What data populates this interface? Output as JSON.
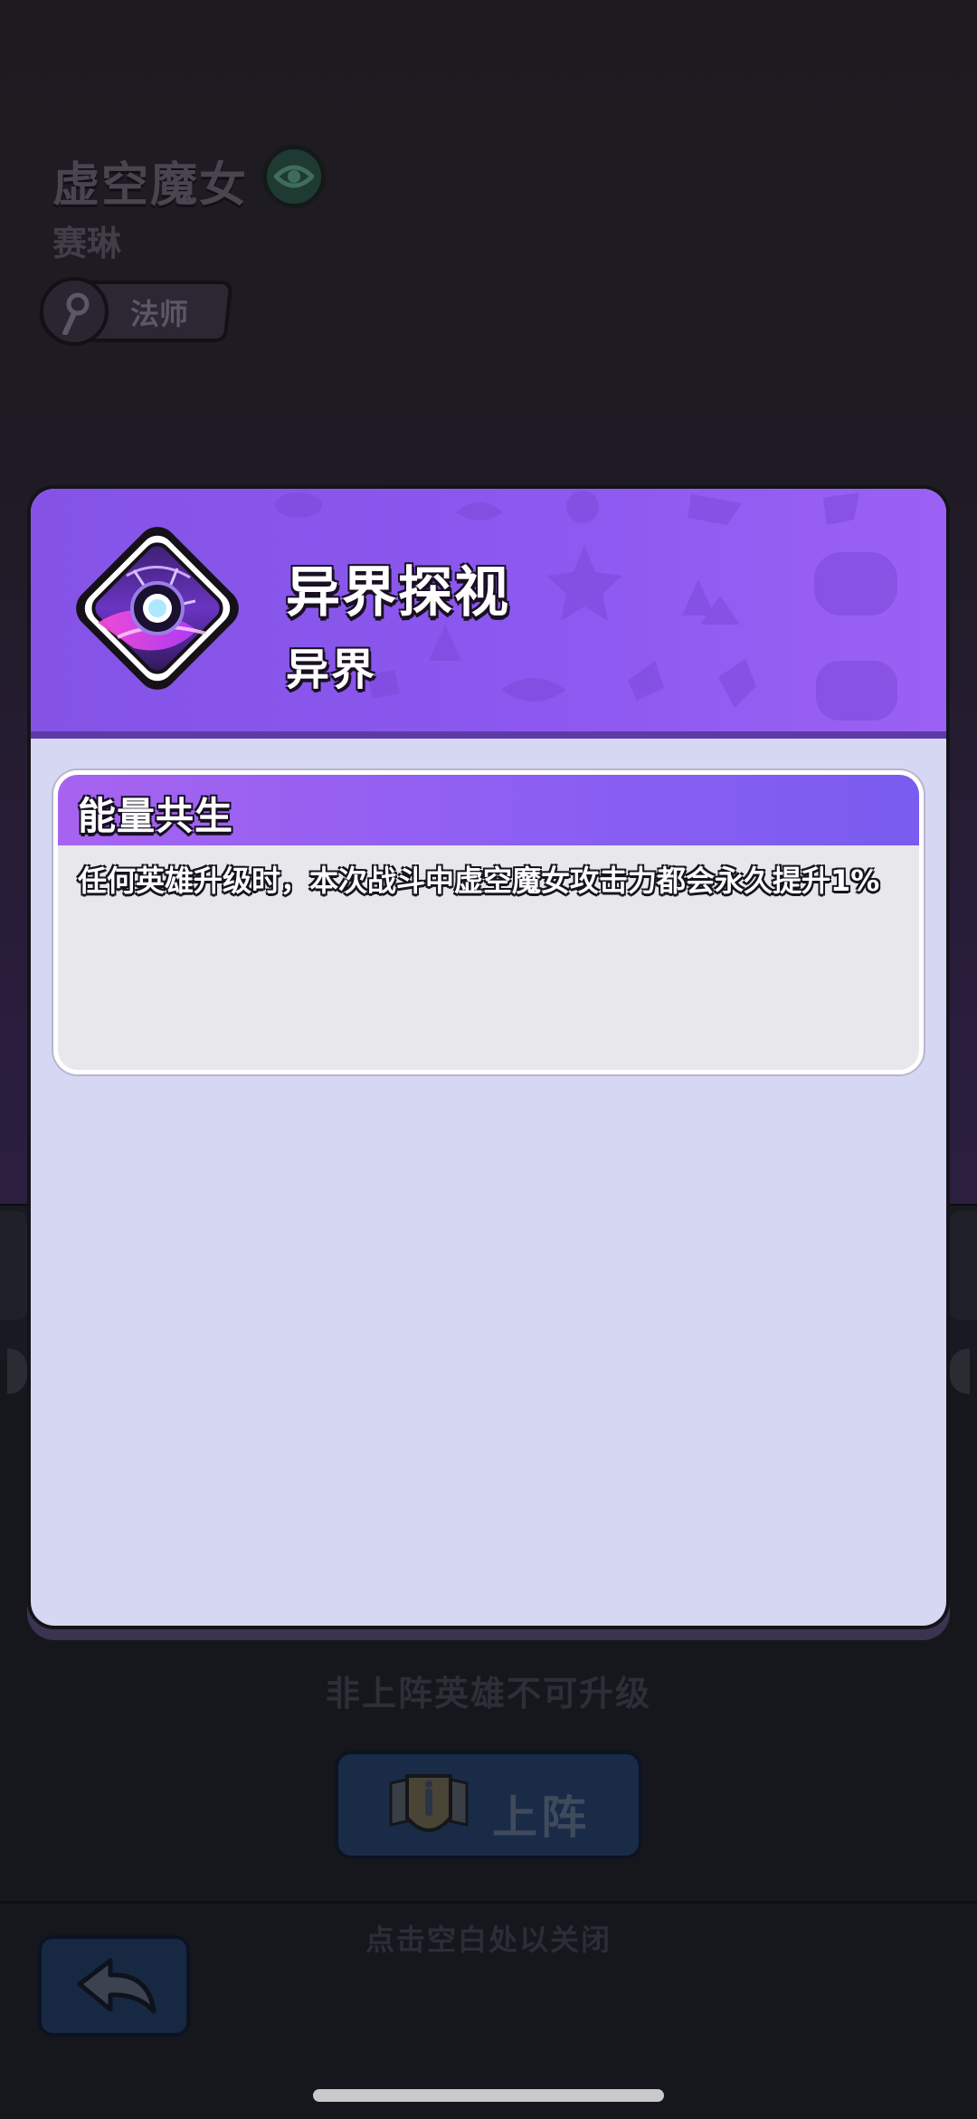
{
  "hero": {
    "name": "虚空魔女",
    "subtitle": "赛琳",
    "role": "法师"
  },
  "skill": {
    "title": "异界探视",
    "category": "异界",
    "effect": {
      "title": "能量共生",
      "description": "任何英雄升级时，本次战斗中虚空魔女攻击力都会永久提升1%"
    }
  },
  "footer": {
    "lock_hint": "非上阵英雄不可升级",
    "deploy_label": "上阵",
    "close_hint": "点击空白处以关闭"
  },
  "icons": {
    "hero_badge": "eye-emblem-icon",
    "role": "staff-icon",
    "skill": "void-eye-icon",
    "deploy": "shield-icon",
    "back": "back-arrow-icon"
  },
  "colors": {
    "header_purple": "#8c58f0",
    "modal_body": "#d6d7f2",
    "effect_card": "#e8e8ec"
  }
}
